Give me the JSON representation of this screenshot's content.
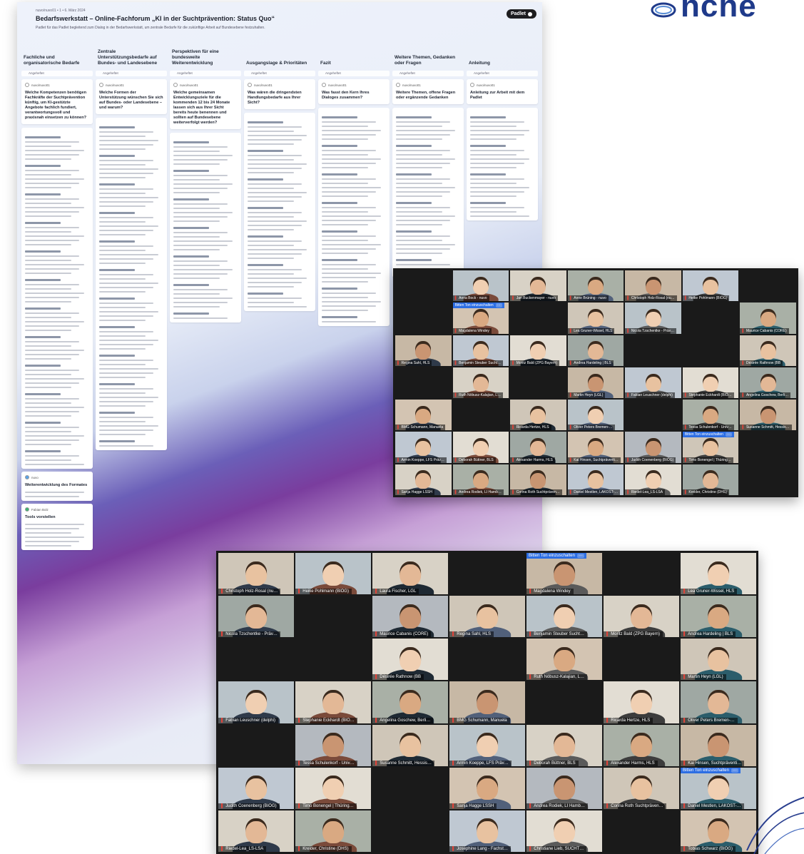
{
  "brand": {
    "word": "hche",
    "accent": "#1f3a8a"
  },
  "padlet": {
    "topline": "nuvo/nuvo01 • 1 • 6. März 2024",
    "title": "Bedarfswerkstatt – Online-Fachforum „KI in der Suchtprävention: Status Quo“",
    "subtitle": "Padlet für das Padlet begleitend zum Dialog in der Bedarfswerkstatt, um zentrale Bedarfe für die zukünftige Arbeit auf Bundesebene festzuhalten.",
    "logo": "Padlet",
    "add_label": "Angeheftet",
    "columns": [
      {
        "title": "Fachliche und organisatorische Bedarfe",
        "card_author": "nuvo/nuvo01",
        "card_title": "Welche Kompetenzen benötigen Fachkräfte der Suchtprävention künftig, um KI-gestützte Angebote fachlich fundiert, verantwortungsvoll und praxisnah einsetzen zu können?"
      },
      {
        "title": "Zentrale Unterstützungsbedarfe auf Bundes- und Landesebene",
        "card_author": "nuvo/nuvo01",
        "card_title": "Welche Formen der Unterstützung wünschen Sie sich auf Bundes- oder Landesebene – und warum?"
      },
      {
        "title": "Perspektiven für eine bundesweite Weiterentwicklung",
        "card_author": "nuvo/nuvo01",
        "card_title": "Welche gemeinsamen Entwicklungsziele für die kommenden 12 bis 24 Monate lassen sich aus Ihrer Sicht bereits heute benennen und sollten auf Bundesebene weiterverfolgt werden?"
      },
      {
        "title": "Ausgangslage & Prioritäten",
        "card_author": "nuvo/nuvo01",
        "card_title": "Was wären die dringendsten Handlungsbedarfe aus Ihrer Sicht?"
      },
      {
        "title": "Fazit",
        "card_author": "nuvo/nuvo01",
        "card_title": "Was fasst den Kern Ihres Dialoges zusammen?"
      },
      {
        "title": "Weitere Themen, Gedanken oder Fragen",
        "card_author": "nuvo/nuvo01",
        "card_title": "Weitere Themen, offene Fragen oder ergänzende Gedanken"
      },
      {
        "title": "Anleitung",
        "card_author": "nuvo/nuvo01",
        "card_title": "Anleitung zur Arbeit mit dem Padlet"
      }
    ],
    "extra_cards": [
      {
        "author": "nuvo",
        "title": "Weiterentwicklung des Formates"
      },
      {
        "author": "Fabian Bolz",
        "title": "Tools vorstellen"
      }
    ]
  },
  "meeting1": {
    "raise_label": "Bitten Ton einzuschalten",
    "more_label": "···",
    "participants": [
      "",
      "Anna Bock - nuvo",
      "Jan Buckenmayer - nuvo",
      "Anne Brüning - nuvo",
      "Christoph Holz-Rosal (nu…",
      "Heike Pohlmann (BIÖG)",
      "",
      "",
      "Magdalena Windey",
      "",
      "Lea Gruner-Wissel, HLS",
      "Nicola Tzschentke - Präv…",
      "",
      "Maurice Cabanis (CORE)",
      "Regina Sahl, HLS",
      "Benjamin Steuber Sucht…",
      "Moritz Bald (ZPG Bayern)",
      "Andrea Hardeling | BLS",
      "",
      "",
      "Désirée Rathnow (BB",
      "",
      "Ruth Nöbusz-Kalajian, L…",
      "",
      "Martin Heyn (LGL)",
      "Fabian Leuschner (delphi)",
      "Stephanie Eckhardt (BIÖ…",
      "Angelina Goschew, Berli…",
      "BMG Schumann, Manuela",
      "",
      "Ricarda Hertze, HLS",
      "Oliver Peters Bremen-…",
      "",
      "Tessa Schulenkorf - Univ…",
      "Susanne Schmitt, Hessis…",
      "Armin Koeppe, LFS Präv…",
      "Deborah Büttner, BLS",
      "Alexander Harms, HLS",
      "Kai Hinsen, Suchtpräventi…",
      "Judith Coenenberg (BIÖG)",
      "Timo Bonengel | Thüring…",
      "",
      "Sanja Hagge LSSH",
      "Andrea Rodiek, LI Hamb…",
      "Corina Roth Suchtpräven…",
      "Daniel Mestlen, LAKOST-…",
      "Riedel-Lea_LS-LSA",
      "Kreider, Christine (DHS)",
      ""
    ]
  },
  "meeting2": {
    "raise_label": "Bitten Ton einzuschalten",
    "more_label": "···",
    "participants": [
      "Christoph Holz-Rosal (nu…",
      "Heike Pohlmann (BIÖG)",
      "Laura Fischer, LGL",
      "",
      "Magdalena Windey",
      "",
      "Lea Gruner-Wissel, HLS",
      "Nicola Tzschentke - Präv…",
      "",
      "Maurice Cabanis (CORE)",
      "Regina Sahl, HLS",
      "Benjamin Steuber Sucht…",
      "Moritz Bald (ZPG Bayern)",
      "Andrea Hardeling | BLS",
      "",
      "",
      "Désirée Rathnow (BB",
      "",
      "Ruth Nöbusz-Kalajian, L…",
      "",
      "Martin Heyn (LGL)",
      "Fabian Leuschner (delphi)",
      "Stephanie Eckhardt (BIÖ…",
      "Angelina Goschew, Berli…",
      "BMG Schumann, Manuela",
      "",
      "Ricarda Hertze, HLS",
      "Oliver Peters Bremen-…",
      "",
      "Tessa Schulenkorf - Univ…",
      "Susanne Schmitt, Hessis…",
      "Armin Koeppe, LFS Präv…",
      "Deborah Büttner, BLS",
      "Alexander Harms, HLS",
      "Kai Hinsen, Suchtpräventi…",
      "Judith Coenenberg (BIÖG)",
      "Timo Bonengel | Thüring…",
      "",
      "Sanja Hagge LSSH",
      "Andrea Rodiek, LI Hamb…",
      "Corina Roth Suchtpräven…",
      "Daniel Mestlen, LAKOST-…",
      "Riedel-Lea_LS-LSA",
      "Kreider, Christine (DHS)",
      "",
      "Josephine Lang - Fachst…",
      "Christiane Lieb, SUCHT…",
      "",
      "Tobias Schwarz (BIÖG)"
    ]
  }
}
